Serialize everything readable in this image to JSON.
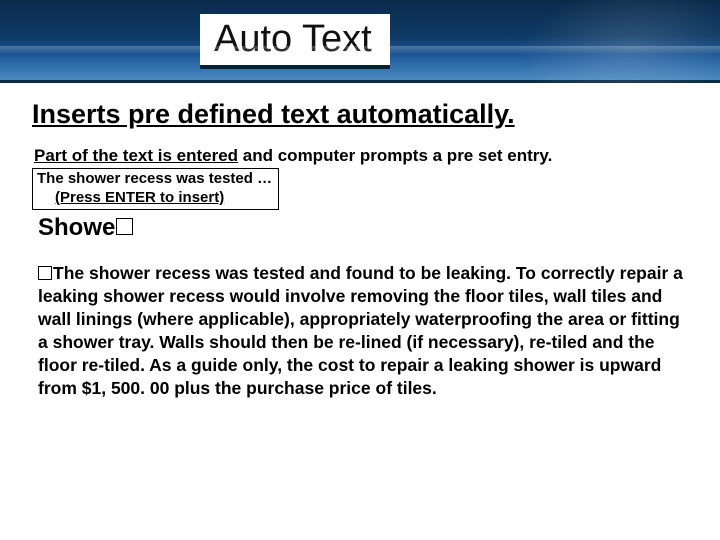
{
  "banner": {
    "title": "Auto Text"
  },
  "body": {
    "subheading": "Inserts pre defined text automatically.",
    "prompt_line_underlined": "Part of the text is entered",
    "prompt_line_rest": " and computer prompts a pre set entry.",
    "tooltip_line1": "The shower recess was tested …",
    "tooltip_line2": "(Press ENTER to insert)",
    "typed_text": "Showe",
    "paragraph": "The shower recess was tested and found to be leaking. To correctly repair a leaking shower recess would involve removing the floor tiles, wall tiles and wall linings (where applicable), appropriately waterproofing the area or fitting a shower tray. Walls should then be re-lined (if necessary), re-tiled and the floor re-tiled. As a guide only, the cost to repair a leaking shower is upward from $1, 500. 00 plus the purchase price of tiles."
  }
}
